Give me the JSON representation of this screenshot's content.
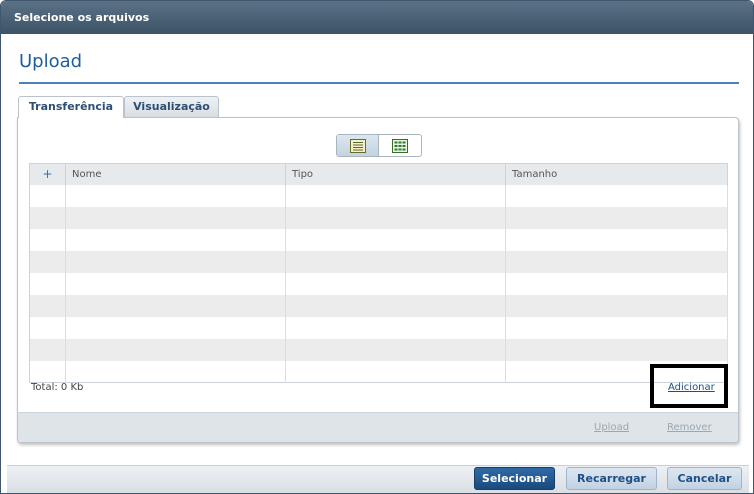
{
  "window": {
    "title": "Selecione os arquivos"
  },
  "page": {
    "title": "Upload"
  },
  "tabs": [
    {
      "label": "Transferência",
      "active": true
    },
    {
      "label": "Visualização",
      "active": false
    }
  ],
  "view_switch": {
    "options": [
      {
        "icon": "list-view-icon",
        "active": true
      },
      {
        "icon": "grid-view-icon",
        "active": false
      }
    ]
  },
  "table": {
    "add_symbol": "+",
    "columns": [
      "Nome",
      "Tipo",
      "Tamanho"
    ],
    "row_count": 9,
    "rows": []
  },
  "total_label": "Total: 0 Kb",
  "add_label": "Adicionar",
  "footer": {
    "upload_label": "Upload",
    "remove_label": "Remover"
  },
  "buttons": {
    "select": "Selecionar",
    "reload": "Recarregar",
    "cancel": "Cancelar"
  },
  "colors": {
    "title_accent": "#1f5d9c",
    "primary_button": "#1b4a7d",
    "titlebar": "#4a6075"
  }
}
